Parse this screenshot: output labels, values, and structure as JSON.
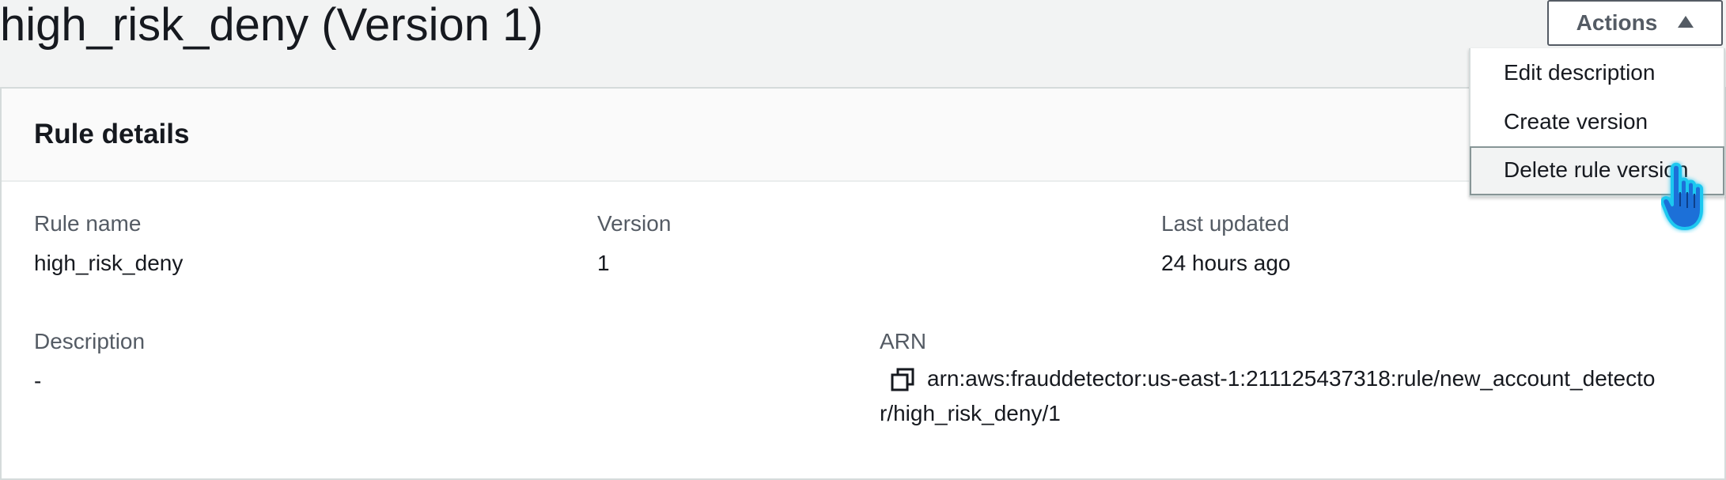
{
  "header": {
    "title": "high_risk_deny (Version 1)",
    "actions_label": "Actions"
  },
  "actions_menu": {
    "items": [
      {
        "label": "Edit description"
      },
      {
        "label": "Create version"
      },
      {
        "label": "Delete rule version",
        "highlighted": true
      }
    ]
  },
  "rule_details": {
    "title": "Rule details",
    "rule_name": {
      "label": "Rule name",
      "value": "high_risk_deny"
    },
    "version": {
      "label": "Version",
      "value": "1"
    },
    "last_updated": {
      "label": "Last updated",
      "value": "24 hours ago"
    },
    "description": {
      "label": "Description",
      "value": "-"
    },
    "arn": {
      "label": "ARN",
      "value_line1": "arn:aws:frauddetector:us-east-1:211125437318:rule/new_account_detecto",
      "value_line2": "r/high_risk_deny/1"
    }
  },
  "colors": {
    "background": "#f2f3f3",
    "panel": "#ffffff",
    "text": "#16191f",
    "label": "#545b64",
    "border": "#d5dbdb",
    "cursor": "#1ec8f0"
  },
  "icons": [
    "caret-up-icon",
    "copy-icon",
    "pointer-cursor-icon"
  ]
}
